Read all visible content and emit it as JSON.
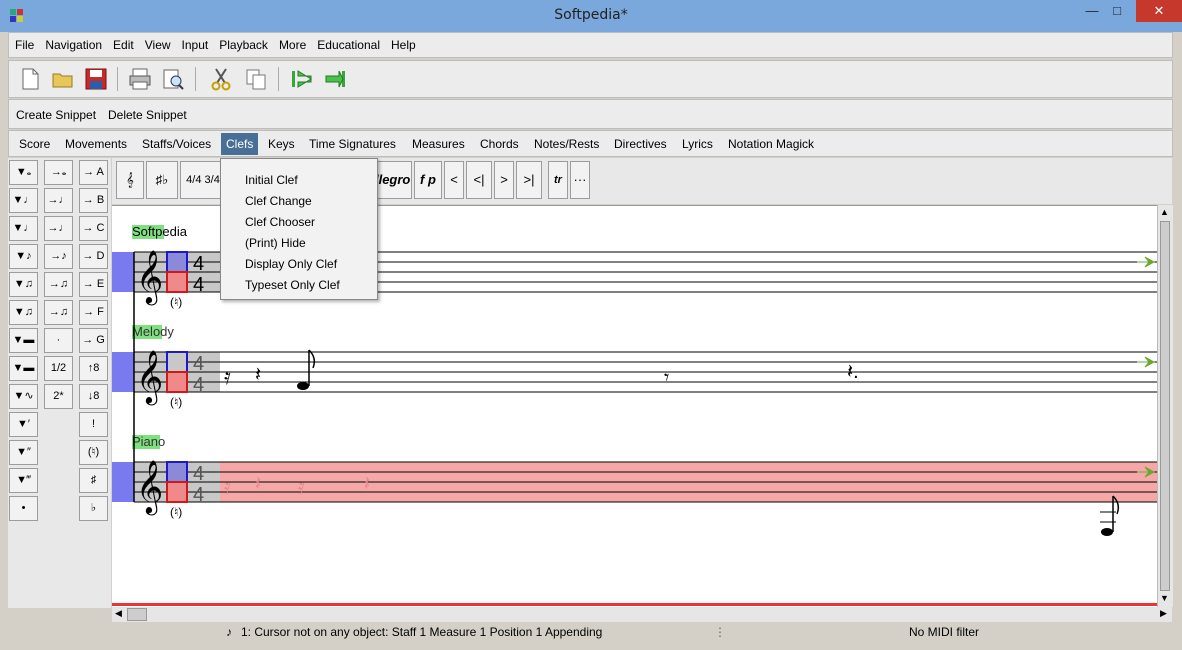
{
  "window": {
    "title": "Softpedia*"
  },
  "menu": [
    "File",
    "Navigation",
    "Edit",
    "View",
    "Input",
    "Playback",
    "More",
    "Educational",
    "Help"
  ],
  "snippet_bar": {
    "create": "Create Snippet",
    "delete": "Delete Snippet"
  },
  "object_menu": [
    "Score",
    "Movements",
    "Staffs/Voices",
    "Clefs",
    "Keys",
    "Time Signatures",
    "Measures",
    "Chords",
    "Notes/Rests",
    "Directives",
    "Lyrics",
    "Notation Magick"
  ],
  "active_menu": "Clefs",
  "clefs_dropdown": [
    "Initial Clef",
    "Clef Change",
    "Clef Chooser",
    "(Print) Hide",
    "Display Only Clef",
    "Typeset Only Clef"
  ],
  "palette_col3": [
    "A",
    "B",
    "C",
    "D",
    "E",
    "F",
    "G",
    "8",
    "8",
    "!",
    "(♮)",
    "♯",
    "♭"
  ],
  "palette_col2": [
    "·",
    "1/2",
    "2*"
  ],
  "command_toolbar": {
    "time_sig": "4/4 3/4",
    "allegro": "Allegro",
    "fp": "f p",
    "nav": [
      "<",
      "<|",
      ">",
      ">|"
    ],
    "tr": "tr",
    "more": "···"
  },
  "staves": [
    {
      "name": "Softpedia",
      "time_top": "4",
      "time_bottom": "4"
    },
    {
      "name": "Melody",
      "time_top": "4",
      "time_bottom": "4"
    },
    {
      "name": "Piano",
      "time_top": "4",
      "time_bottom": "4"
    }
  ],
  "status": {
    "cursor": "1: Cursor not on any object:  Staff 1 Measure 1 Position 1 Appending",
    "midi": "No MIDI filter"
  },
  "colors": {
    "staff_highlight": "#f6a8a8",
    "active_menu": "#4a6f96",
    "name_highlight": "#7fe07f"
  }
}
